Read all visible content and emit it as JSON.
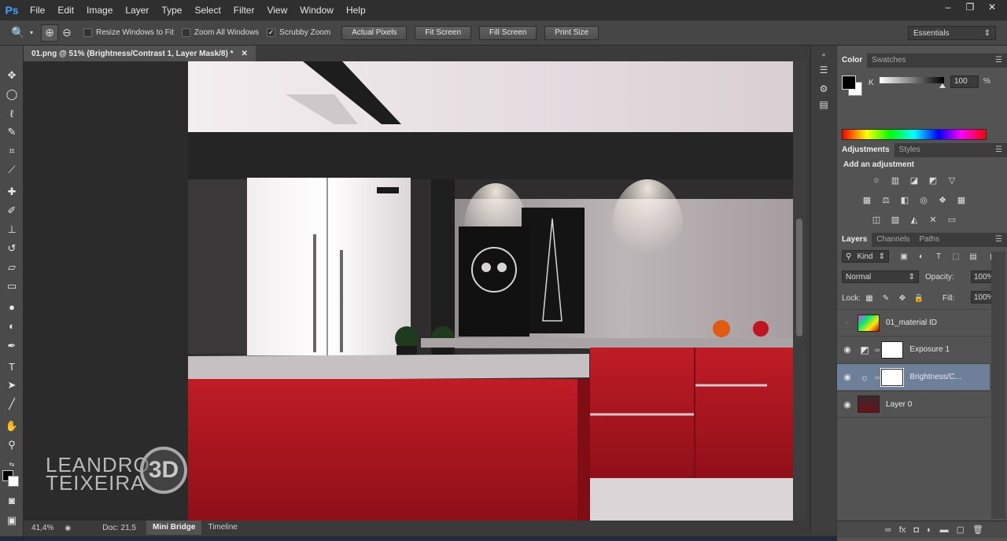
{
  "app": {
    "logo": "Ps"
  },
  "menu": [
    "File",
    "Edit",
    "Image",
    "Layer",
    "Type",
    "Select",
    "Filter",
    "View",
    "Window",
    "Help"
  ],
  "window_controls": {
    "minimize": "–",
    "restore": "❐",
    "close": "✕"
  },
  "options": {
    "resize_windows": "Resize Windows to Fit",
    "zoom_all": "Zoom All Windows",
    "scrubby_zoom": "Scrubby Zoom",
    "buttons": [
      "Actual Pixels",
      "Fit Screen",
      "Fill Screen",
      "Print Size"
    ],
    "workspace": "Essentials"
  },
  "document": {
    "tab_title": "01.png @ 51% (Brightness/Contrast 1, Layer Mask/8) *",
    "zoom": "41,4%",
    "doc_info": "Doc: 21,5"
  },
  "bottom_tabs": [
    "Mini Bridge",
    "Timeline"
  ],
  "watermark": {
    "line1": "LEANDRO",
    "line2": "TEIXEIRA",
    "badge": "3D"
  },
  "color_panel": {
    "tabs": [
      "Color",
      "Swatches"
    ],
    "channel": "K",
    "value": "100",
    "unit": "%",
    "level": 100
  },
  "adjustments_panel": {
    "tabs": [
      "Adjustments",
      "Styles"
    ],
    "title": "Add an adjustment"
  },
  "layers_panel": {
    "tabs": [
      "Layers",
      "Channels",
      "Paths"
    ],
    "kind": "Kind",
    "blend_mode": "Normal",
    "opacity_label": "Opacity:",
    "opacity": "100%",
    "lock_label": "Lock:",
    "fill_label": "Fill:",
    "fill": "100%",
    "layers": [
      {
        "name": "01_material ID",
        "visible": false
      },
      {
        "name": "Exposure 1",
        "visible": true
      },
      {
        "name": "Brightness/C...",
        "visible": true
      },
      {
        "name": "Layer 0",
        "visible": true
      }
    ]
  },
  "colors": {
    "accent": "#39a3ff",
    "selected_layer": "#6e7f9a",
    "cabinet_red": "#b3161f"
  }
}
